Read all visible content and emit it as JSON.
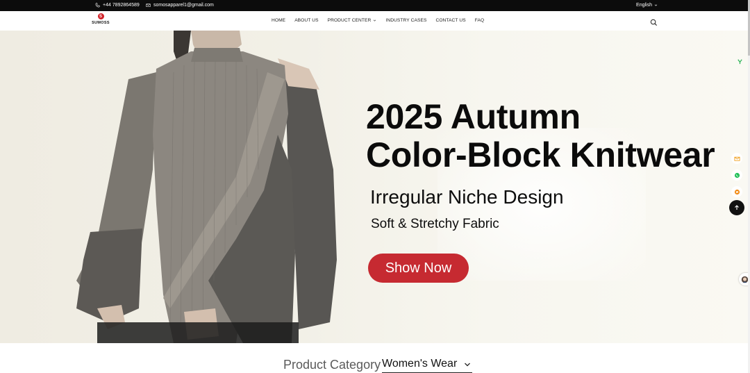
{
  "topbar": {
    "phone": "+44 7892864589",
    "email": "somosapparel1@gmail.com",
    "language": "English",
    "icons": {
      "phone": "phone-icon",
      "email": "envelope-icon",
      "language": "chevron-down-icon"
    }
  },
  "nav": {
    "logo_mark": "S",
    "logo_text": "SUMOSS",
    "menu": [
      {
        "label": "HOME"
      },
      {
        "label": "ABOUT US"
      },
      {
        "label": "PRODUCT CENTER",
        "has_dropdown": true
      },
      {
        "label": "INDUSTRY CASES"
      },
      {
        "label": "CONTACT US"
      },
      {
        "label": "FAQ"
      }
    ],
    "search_icon": "search-icon"
  },
  "hero": {
    "line1": "2025 Autumn",
    "line2": "Color-Block Knitwear",
    "sub1": "Irregular Niche Design",
    "sub2": "Soft & Stretchy Fabric",
    "cta": "Show Now",
    "colors": {
      "cta": "#c62a31",
      "headline": "#0b0b0b"
    }
  },
  "floating": {
    "icons": [
      "brand-icon",
      "envelope-icon",
      "whatsapp-icon",
      "message-icon",
      "arrow-up-icon",
      "chat-avatar-icon"
    ],
    "colors": {
      "envelope": "#f0a020",
      "whatsapp": "#25c15b",
      "message": "#f28c16",
      "back_to_top": "#111111"
    }
  },
  "product_category": {
    "title": "Product Category",
    "selected": "Women's Wear"
  }
}
